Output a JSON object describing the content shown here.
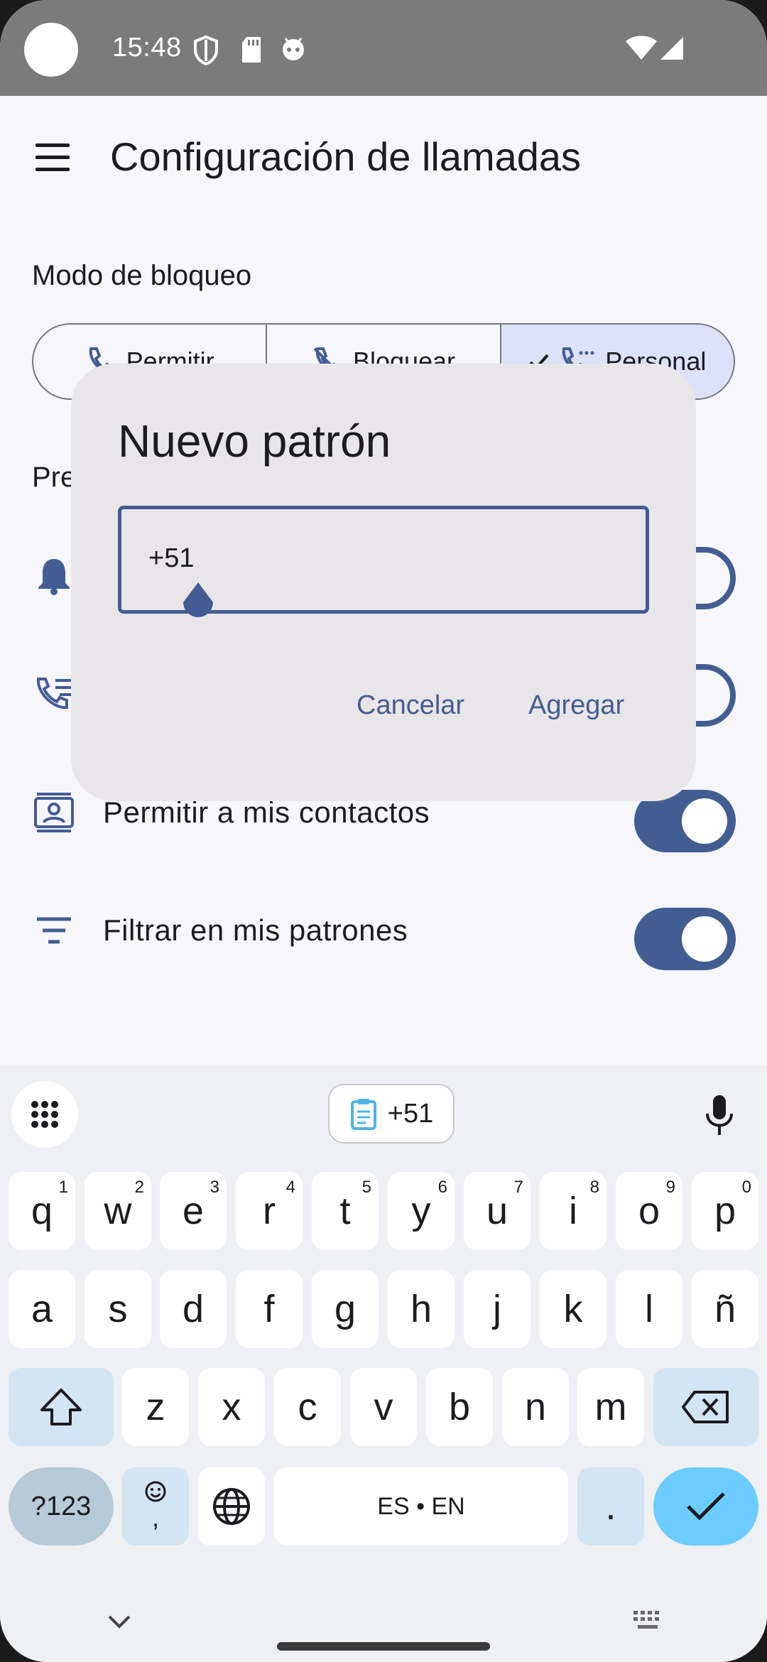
{
  "status_bar": {
    "time": "15:48",
    "icons": [
      "shield-icon",
      "sd-card-icon",
      "android-icon",
      "wifi-icon",
      "signal-icon"
    ]
  },
  "app_bar": {
    "title": "Configuración de llamadas",
    "menu_icon": "menu-icon"
  },
  "section_block_mode": {
    "label": "Modo de bloqueo",
    "segments": [
      {
        "label": "Permitir",
        "icon": "phone-icon",
        "selected": false
      },
      {
        "label": "Bloquear",
        "icon": "phone-blocked-icon",
        "selected": false
      },
      {
        "label": "Personal",
        "icon": "phone-custom-icon",
        "selected": true
      }
    ]
  },
  "section_prefs": {
    "label": "Pre"
  },
  "settings_rows": [
    {
      "label": "Permitir a mis contactos",
      "icon": "contacts-icon",
      "enabled": true
    },
    {
      "label": "Filtrar en mis patrones",
      "icon": "filter-icon",
      "enabled": true
    }
  ],
  "dialog": {
    "title": "Nuevo patrón",
    "input_value": "+51",
    "cancel_label": "Cancelar",
    "add_label": "Agregar"
  },
  "keyboard": {
    "clipboard_suggestion": "+51",
    "row1": [
      {
        "key": "q",
        "hint": "1"
      },
      {
        "key": "w",
        "hint": "2"
      },
      {
        "key": "e",
        "hint": "3"
      },
      {
        "key": "r",
        "hint": "4"
      },
      {
        "key": "t",
        "hint": "5"
      },
      {
        "key": "y",
        "hint": "6"
      },
      {
        "key": "u",
        "hint": "7"
      },
      {
        "key": "i",
        "hint": "8"
      },
      {
        "key": "o",
        "hint": "9"
      },
      {
        "key": "p",
        "hint": "0"
      }
    ],
    "row2": [
      "a",
      "s",
      "d",
      "f",
      "g",
      "h",
      "j",
      "k",
      "l",
      "ñ"
    ],
    "row3": [
      "z",
      "x",
      "c",
      "v",
      "b",
      "n",
      "m"
    ],
    "symbols_label": "?123",
    "emoji_comma": ",",
    "space_label": "ES • EN",
    "period_label": "."
  },
  "colors": {
    "accent": "#435d93",
    "dialog_bg": "#e9e6ea",
    "selected_segment": "#dbe2f9",
    "enter_key": "#6cccff"
  }
}
